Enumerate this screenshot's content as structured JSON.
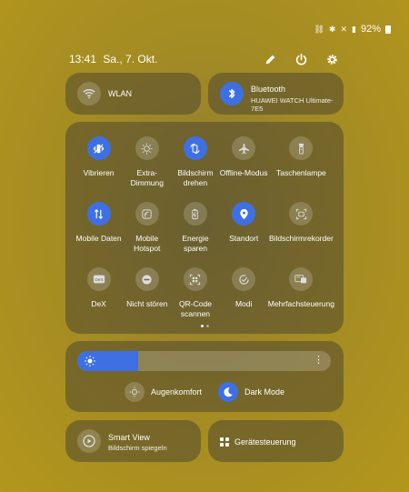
{
  "status": {
    "battery": "92%"
  },
  "header": {
    "time": "13:41",
    "date": "Sa., 7. Okt."
  },
  "wlan": {
    "label": "WLAN"
  },
  "bluetooth": {
    "label": "Bluetooth",
    "device": "HUAWEI WATCH Ultimate-7E5"
  },
  "tiles": [
    {
      "label": "Vibrieren",
      "icon": "vibrate-icon",
      "on": true
    },
    {
      "label": "Extra-Dimmung",
      "icon": "extra-dim-icon",
      "on": false
    },
    {
      "label": "Bildschirm drehen",
      "icon": "rotate-icon",
      "on": true
    },
    {
      "label": "Offline-Modus",
      "icon": "airplane-icon",
      "on": false
    },
    {
      "label": "Taschenlampe",
      "icon": "flashlight-icon",
      "on": false
    },
    {
      "label": "Mobile Daten",
      "icon": "mobile-data-icon",
      "on": true
    },
    {
      "label": "Mobile Hotspot",
      "icon": "hotspot-icon",
      "on": false
    },
    {
      "label": "Energie sparen",
      "icon": "battery-saver-icon",
      "on": false
    },
    {
      "label": "Standort",
      "icon": "location-icon",
      "on": true
    },
    {
      "label": "Bildschirmrekorder",
      "icon": "screen-recorder-icon",
      "on": false
    },
    {
      "label": "DeX",
      "icon": "dex-icon",
      "on": false
    },
    {
      "label": "Nicht stören",
      "icon": "do-not-disturb-icon",
      "on": false
    },
    {
      "label": "QR-Code scannen",
      "icon": "qr-scan-icon",
      "on": false
    },
    {
      "label": "Modi",
      "icon": "modes-icon",
      "on": false
    },
    {
      "label": "Mehrfachsteuerung",
      "icon": "multi-control-icon",
      "on": false
    }
  ],
  "brightness": {
    "level": 0.24
  },
  "eye_comfort": {
    "label": "Augenkomfort"
  },
  "dark_mode": {
    "label": "Dark Mode"
  },
  "smart_view": {
    "label": "Smart View",
    "sub": "Bildschirm spiegeln"
  },
  "device_control": {
    "label": "Gerätesteuerung"
  },
  "colors": {
    "accent": "#3e6fe3"
  }
}
